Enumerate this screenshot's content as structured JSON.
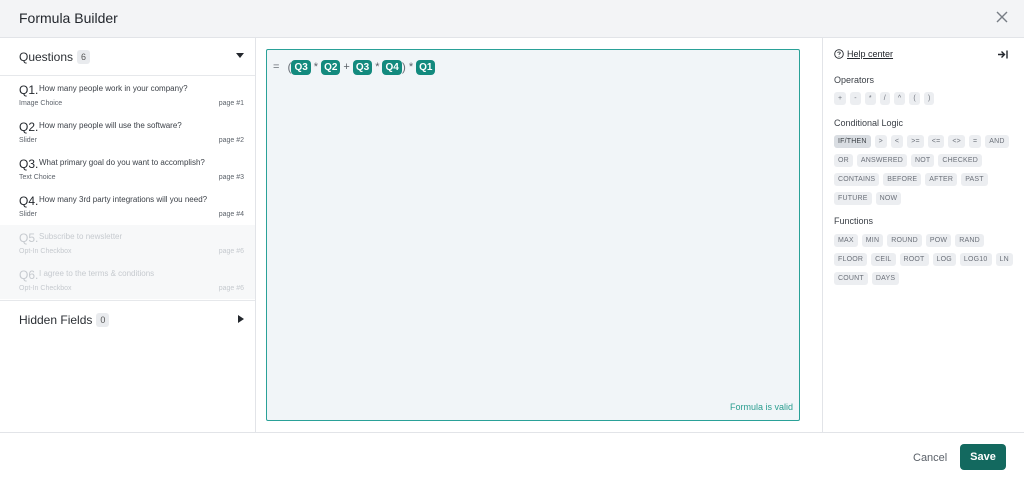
{
  "header": {
    "title": "Formula Builder",
    "close_icon": "close-icon"
  },
  "questions": {
    "label": "Questions",
    "count": "6",
    "items": [
      {
        "num": "Q1.",
        "text": "How many people work in your company?",
        "type": "Image Choice",
        "page": "page #1",
        "disabled": false
      },
      {
        "num": "Q2.",
        "text": "How many people will use the software?",
        "type": "Slider",
        "page": "page #2",
        "disabled": false
      },
      {
        "num": "Q3.",
        "text": "What primary goal do you want to accomplish?",
        "type": "Text Choice",
        "page": "page #3",
        "disabled": false
      },
      {
        "num": "Q4.",
        "text": "How many 3rd party integrations will you need?",
        "type": "Slider",
        "page": "page #4",
        "disabled": false
      },
      {
        "num": "Q5.",
        "text": "Subscribe to newsletter",
        "type": "Opt-In Checkbox",
        "page": "page #6",
        "disabled": true
      },
      {
        "num": "Q6.",
        "text": "I agree to the terms & conditions",
        "type": "Opt-In Checkbox",
        "page": "page #6",
        "disabled": true
      }
    ]
  },
  "hidden_fields": {
    "label": "Hidden Fields",
    "count": "0"
  },
  "formula": {
    "eq": "=",
    "open_paren": "(",
    "close_paren": ")",
    "tokens": [
      "Q3",
      "Q2",
      "Q3",
      "Q4",
      "Q1"
    ],
    "ops": [
      "*",
      "+",
      "*",
      "*"
    ],
    "status": "Formula is valid"
  },
  "sidebar": {
    "help_label": "Help center",
    "operators_title": "Operators",
    "operators": [
      "+",
      "-",
      "*",
      "/",
      "^",
      "(",
      ")"
    ],
    "logic_title": "Conditional Logic",
    "logic": [
      "IF/THEN",
      ">",
      "<",
      ">=",
      "<=",
      "<>",
      "=",
      "AND",
      "OR",
      "ANSWERED",
      "NOT",
      "CHECKED",
      "CONTAINS",
      "BEFORE",
      "AFTER",
      "PAST",
      "FUTURE",
      "NOW"
    ],
    "functions_title": "Functions",
    "functions": [
      "MAX",
      "MIN",
      "ROUND",
      "POW",
      "RAND",
      "FLOOR",
      "CEIL",
      "ROOT",
      "LOG",
      "LOG10",
      "LN",
      "COUNT",
      "DAYS"
    ]
  },
  "footer": {
    "cancel_label": "Cancel",
    "save_label": "Save"
  },
  "colors": {
    "accent": "#138a7e",
    "save": "#13695f",
    "valid": "#2a9d8f"
  }
}
